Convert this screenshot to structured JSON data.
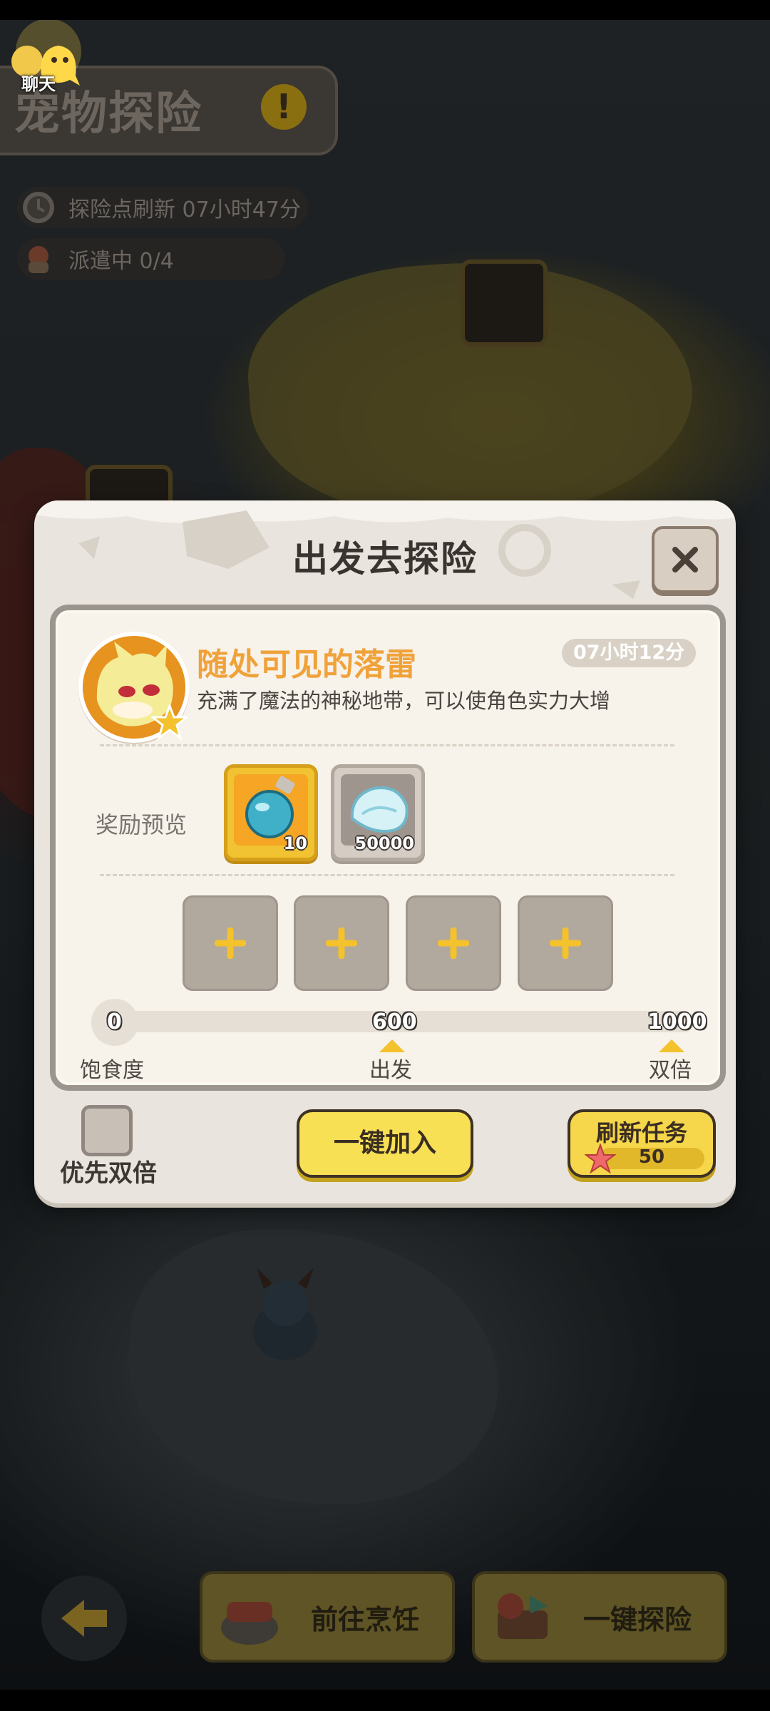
{
  "topbar": {
    "chat_label": "聊天",
    "title": "宠物探险",
    "alert_symbol": "!",
    "refresh_info": "探险点刷新 07小时47分",
    "dispatch_info": "派遣中 0/4"
  },
  "modal": {
    "title": "出发去探险",
    "close_icon": "close-icon",
    "task": {
      "name": "随处可见的落雷",
      "time_left": "07小时12分",
      "description": "充满了魔法的神秘地带，可以使角色实力大增"
    },
    "rewards": {
      "label": "奖励预览",
      "items": [
        {
          "icon": "blue-potion-icon",
          "count": "10",
          "rarity": "gold"
        },
        {
          "icon": "blue-shell-icon",
          "count": "50000",
          "rarity": "grey"
        }
      ]
    },
    "pet_slots": [
      {
        "icon": "plus-icon"
      },
      {
        "icon": "plus-icon"
      },
      {
        "icon": "plus-icon"
      },
      {
        "icon": "plus-icon"
      }
    ],
    "satiety": {
      "current": "0",
      "depart_threshold": "600",
      "double_threshold": "1000",
      "label": "饱食度",
      "depart_label": "出发",
      "double_label": "双倍",
      "fill_fraction": 0
    },
    "priority_double_label": "优先双倍",
    "priority_double_checked": false,
    "join_button": "一键加入",
    "refresh_button": {
      "label": "刷新任务",
      "cost": "50",
      "cost_icon": "starfish-icon"
    }
  },
  "bottom": {
    "back_icon": "back-arrow-icon",
    "cook_button": "前往烹饪",
    "explore_button": "一键探险"
  },
  "colors": {
    "task_name": "#f0a23a",
    "button_yellow": "#f8e055",
    "modal_bg": "#e9e5de",
    "reward_gold": "#f1c231"
  }
}
